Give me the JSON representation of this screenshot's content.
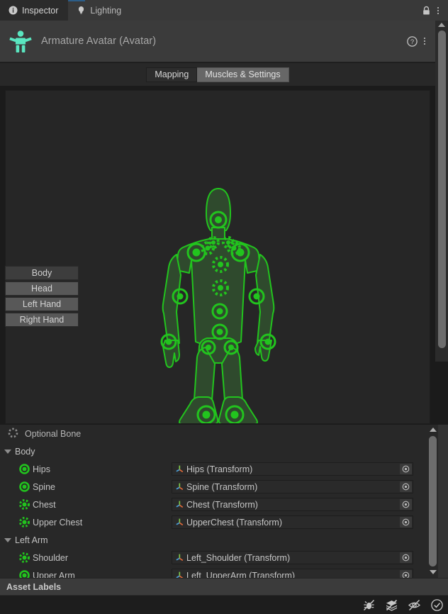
{
  "window": {
    "tabs": [
      {
        "label": "Inspector",
        "icon": "info-icon",
        "active": true
      },
      {
        "label": "Lighting",
        "icon": "lightbulb-icon",
        "active": false
      }
    ],
    "lock_icon": "lock-icon",
    "menu_icon": "kebab-menu-icon",
    "accent_color": "#2c5d87"
  },
  "asset_header": {
    "title": "Armature Avatar (Avatar)",
    "icon": "avatar-humanoid-icon",
    "icon_color": "#5ae6c0",
    "help_icon": "help-icon",
    "menu_icon": "kebab-menu-icon"
  },
  "mode_tabs": [
    {
      "label": "Mapping",
      "selected": true
    },
    {
      "label": "Muscles & Settings",
      "selected": false
    }
  ],
  "preview": {
    "background": "#262626",
    "bone_color": "#22c41e",
    "body_fill": "#2f4a2d",
    "part_buttons": [
      {
        "label": "Body",
        "selected": true
      },
      {
        "label": "Head",
        "selected": false
      },
      {
        "label": "Left Hand",
        "selected": false
      },
      {
        "label": "Right Hand",
        "selected": false
      }
    ]
  },
  "bone_list": {
    "legend": {
      "label": "Optional Bone",
      "marker": "dashed-circle-icon"
    },
    "groups": [
      {
        "name": "Body",
        "expanded": true,
        "bones": [
          {
            "name": "Hips",
            "marker": "solid-circle-icon",
            "value": "Hips (Transform)",
            "picker": "object-picker-icon"
          },
          {
            "name": "Spine",
            "marker": "solid-circle-icon",
            "value": "Spine (Transform)",
            "picker": "object-picker-icon"
          },
          {
            "name": "Chest",
            "marker": "dashed-circle-icon",
            "value": "Chest (Transform)",
            "picker": "object-picker-icon"
          },
          {
            "name": "Upper Chest",
            "marker": "dashed-circle-icon",
            "value": "UpperChest (Transform)",
            "picker": "object-picker-icon"
          }
        ]
      },
      {
        "name": "Left Arm",
        "expanded": true,
        "bones": [
          {
            "name": "Shoulder",
            "marker": "dashed-circle-icon",
            "value": "Left_Shoulder (Transform)",
            "picker": "object-picker-icon"
          },
          {
            "name": "Upper Arm",
            "marker": "solid-circle-icon",
            "value": "Left_UpperArm (Transform)",
            "picker": "object-picker-icon"
          }
        ]
      }
    ]
  },
  "labels_bar": {
    "title": "Asset Labels"
  },
  "status_bar": {
    "icons": [
      {
        "name": "bug-disabled-icon"
      },
      {
        "name": "layers-disabled-icon"
      },
      {
        "name": "eye-disabled-icon"
      },
      {
        "name": "check-circle-icon"
      }
    ]
  }
}
